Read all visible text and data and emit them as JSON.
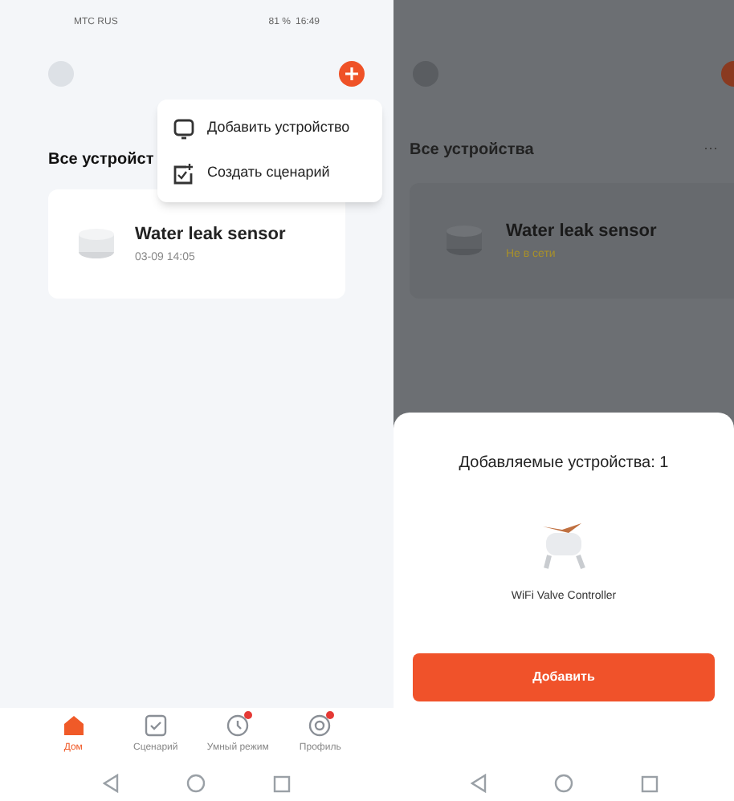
{
  "left_screen": {
    "status_bar": {
      "carrier": "МТС RUS",
      "battery": "81 %",
      "time": "16:49"
    },
    "menu": [
      {
        "kind": "device",
        "label": "Добавить устройство"
      },
      {
        "kind": "scene",
        "label": "Создать сценарий"
      }
    ],
    "heading": "Все устройст",
    "device": {
      "name": "Water leak sensor",
      "detail": "03-09 14:05"
    },
    "tabs": [
      {
        "kind": "home",
        "label": "Дом",
        "selected": true,
        "badge": false
      },
      {
        "kind": "scene",
        "label": "Сценарий",
        "selected": false,
        "badge": false
      },
      {
        "kind": "smart",
        "label": "Умный режим",
        "selected": false,
        "badge": true
      },
      {
        "kind": "profile",
        "label": "Профиль",
        "selected": false,
        "badge": true
      }
    ]
  },
  "right_screen": {
    "heading": "Все устройства",
    "more": "···",
    "device": {
      "name": "Water leak sensor",
      "status": "Не в сети"
    },
    "sheet": {
      "title": "Добавляемые устройства: 1",
      "device_name": "WiFi Valve Controller",
      "button": "Добавить"
    }
  }
}
